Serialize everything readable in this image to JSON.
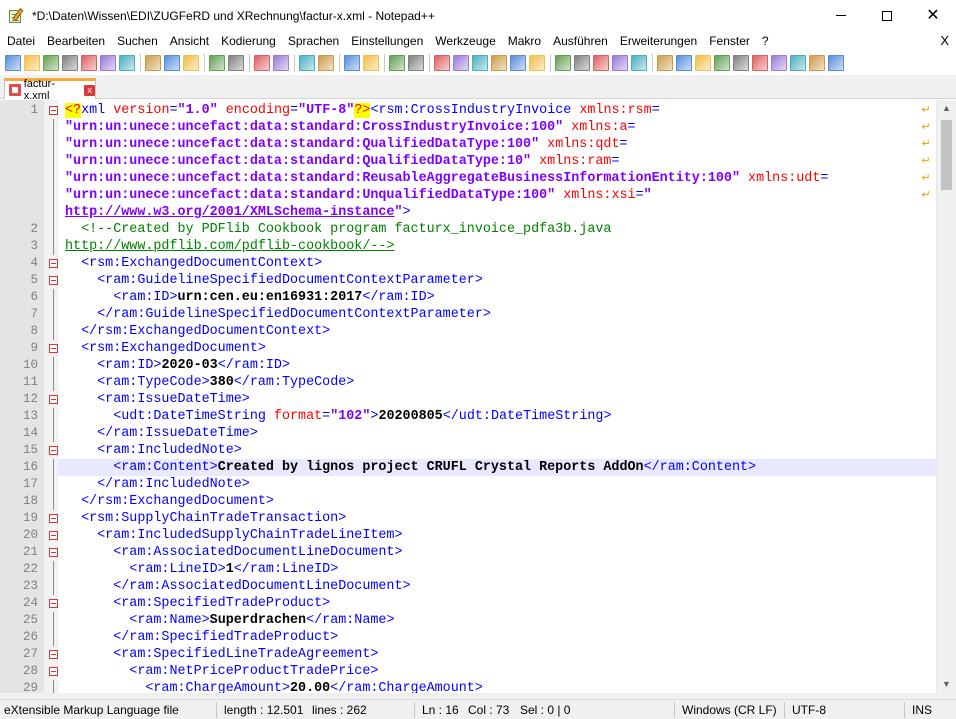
{
  "window": {
    "title": "*D:\\Daten\\Wissen\\EDI\\ZUGFeRD und XRechnung\\factur-x.xml - Notepad++"
  },
  "menu": {
    "items": [
      "Datei",
      "Bearbeiten",
      "Suchen",
      "Ansicht",
      "Kodierung",
      "Sprachen",
      "Einstellungen",
      "Werkzeuge",
      "Makro",
      "Ausführen",
      "Erweiterungen",
      "Fenster",
      "?"
    ],
    "close_label": "X"
  },
  "tab": {
    "label": "factur-x.xml",
    "close_label": "x"
  },
  "editor": {
    "current_line": 16,
    "lines": [
      {
        "num": "1",
        "html": "<span class=\"t-decl\">&lt;?</span><span class=\"t-tag\">xml </span><span class=\"t-attr\">version</span><span class=\"t-tag\">=</span><span class=\"t-val\">\"1.0\"</span><span class=\"t-tag\"> </span><span class=\"t-attr\">encoding</span><span class=\"t-tag\">=</span><span class=\"t-val\">\"UTF-8\"</span><span class=\"t-decl\">?&gt;</span><span class=\"t-tag\">&lt;rsm:CrossIndustryInvoice </span><span class=\"t-attr\">xmlns:rsm</span><span class=\"t-tag\">=</span>"
      },
      {
        "num": "",
        "html": "<span class=\"t-val\">\"urn:un:unece:uncefact:data:standard:CrossIndustryInvoice:100\"</span><span class=\"t-tag\"> </span><span class=\"t-attr\">xmlns:a</span><span class=\"t-tag\">=</span>"
      },
      {
        "num": "",
        "html": "<span class=\"t-val\">\"urn:un:unece:uncefact:data:standard:QualifiedDataType:100\"</span><span class=\"t-tag\"> </span><span class=\"t-attr\">xmlns:qdt</span><span class=\"t-tag\">=</span>"
      },
      {
        "num": "",
        "html": "<span class=\"t-val\">\"urn:un:unece:uncefact:data:standard:QualifiedDataType:10\"</span><span class=\"t-tag\"> </span><span class=\"t-attr\">xmlns:ram</span><span class=\"t-tag\">=</span>"
      },
      {
        "num": "",
        "html": "<span class=\"t-val\">\"urn:un:unece:uncefact:data:standard:ReusableAggregateBusinessInformationEntity:100\"</span><span class=\"t-tag\"> </span><span class=\"t-attr\">xmlns:udt</span><span class=\"t-tag\">=</span>"
      },
      {
        "num": "",
        "html": "<span class=\"t-val\">\"urn:un:unece:uncefact:data:standard:UnqualifiedDataType:100\"</span><span class=\"t-tag\"> </span><span class=\"t-attr\">xmlns:xsi</span><span class=\"t-tag\">=</span><span class=\"t-val\">\"</span>"
      },
      {
        "num": "",
        "html": "<span class=\"t-url\">http://www.w3.org/2001/XMLSchema-instance</span><span class=\"t-val\">\"</span><span class=\"t-tag\">&gt;</span>"
      },
      {
        "num": "2",
        "html": "<span class=\"t-comment\">  &lt;!--Created by PDFlib Cookbook program facturx_invoice_pdfa3b.java</span>"
      },
      {
        "num": "3",
        "html": "<span class=\"t-urlc\">http://www.pdflib.com/pdflib-cookbook/--&gt;</span>"
      },
      {
        "num": "4",
        "html": "<span class=\"t-tag\">  &lt;rsm:ExchangedDocumentContext&gt;</span>"
      },
      {
        "num": "5",
        "html": "<span class=\"t-tag\">    &lt;ram:GuidelineSpecifiedDocumentContextParameter&gt;</span>"
      },
      {
        "num": "6",
        "html": "<span class=\"t-tag\">      &lt;ram:ID&gt;</span><span class=\"t-text\">urn:cen.eu:en16931:2017</span><span class=\"t-tag\">&lt;/ram:ID&gt;</span>"
      },
      {
        "num": "7",
        "html": "<span class=\"t-tag\">    &lt;/ram:GuidelineSpecifiedDocumentContextParameter&gt;</span>"
      },
      {
        "num": "8",
        "html": "<span class=\"t-tag\">  &lt;/rsm:ExchangedDocumentContext&gt;</span>"
      },
      {
        "num": "9",
        "html": "<span class=\"t-tag\">  &lt;rsm:ExchangedDocument&gt;</span>"
      },
      {
        "num": "10",
        "html": "<span class=\"t-tag\">    &lt;ram:ID&gt;</span><span class=\"t-text\">2020-03</span><span class=\"t-tag\">&lt;/ram:ID&gt;</span>"
      },
      {
        "num": "11",
        "html": "<span class=\"t-tag\">    &lt;ram:TypeCode&gt;</span><span class=\"t-text\">380</span><span class=\"t-tag\">&lt;/ram:TypeCode&gt;</span>"
      },
      {
        "num": "12",
        "html": "<span class=\"t-tag\">    &lt;ram:IssueDateTime&gt;</span>"
      },
      {
        "num": "13",
        "html": "<span class=\"t-tag\">      &lt;udt:DateTimeString </span><span class=\"t-attr\">format</span><span class=\"t-tag\">=</span><span class=\"t-val\">\"102\"</span><span class=\"t-tag\">&gt;</span><span class=\"t-text\">20200805</span><span class=\"t-tag\">&lt;/udt:DateTimeString&gt;</span>"
      },
      {
        "num": "14",
        "html": "<span class=\"t-tag\">    &lt;/ram:IssueDateTime&gt;</span>"
      },
      {
        "num": "15",
        "html": "<span class=\"t-tag\">    &lt;ram:IncludedNote&gt;</span>"
      },
      {
        "num": "16",
        "html": "<span class=\"t-tag\">      &lt;ram:Content&gt;</span><span class=\"t-text\">Created by lignos project CRUFL Crystal Reports AddOn</span><span class=\"t-tag\">&lt;/ram:Content&gt;</span>"
      },
      {
        "num": "17",
        "html": "<span class=\"t-tag\">    &lt;/ram:IncludedNote&gt;</span>"
      },
      {
        "num": "18",
        "html": "<span class=\"t-tag\">  &lt;/rsm:ExchangedDocument&gt;</span>"
      },
      {
        "num": "19",
        "html": "<span class=\"t-tag\">  &lt;rsm:SupplyChainTradeTransaction&gt;</span>"
      },
      {
        "num": "20",
        "html": "<span class=\"t-tag\">    &lt;ram:IncludedSupplyChainTradeLineItem&gt;</span>"
      },
      {
        "num": "21",
        "html": "<span class=\"t-tag\">      &lt;ram:AssociatedDocumentLineDocument&gt;</span>"
      },
      {
        "num": "22",
        "html": "<span class=\"t-tag\">        &lt;ram:LineID&gt;</span><span class=\"t-text\">1</span><span class=\"t-tag\">&lt;/ram:LineID&gt;</span>"
      },
      {
        "num": "23",
        "html": "<span class=\"t-tag\">      &lt;/ram:AssociatedDocumentLineDocument&gt;</span>"
      },
      {
        "num": "24",
        "html": "<span class=\"t-tag\">      &lt;ram:SpecifiedTradeProduct&gt;</span>"
      },
      {
        "num": "25",
        "html": "<span class=\"t-tag\">        &lt;ram:Name&gt;</span><span class=\"t-text\">Superdrachen</span><span class=\"t-tag\">&lt;/ram:Name&gt;</span>"
      },
      {
        "num": "26",
        "html": "<span class=\"t-tag\">      &lt;/ram:SpecifiedTradeProduct&gt;</span>"
      },
      {
        "num": "27",
        "html": "<span class=\"t-tag\">      &lt;ram:SpecifiedLineTradeAgreement&gt;</span>"
      },
      {
        "num": "28",
        "html": "<span class=\"t-tag\">        &lt;ram:NetPriceProductTradePrice&gt;</span>"
      },
      {
        "num": "29",
        "html": "<span class=\"t-tag\">          &lt;ram:ChargeAmount&gt;</span><span class=\"t-text\">20.00</span><span class=\"t-tag\">&lt;/ram:ChargeAmount&gt;</span>"
      }
    ]
  },
  "status": {
    "file_type": "eXtensible Markup Language file",
    "length": "length : 12.501",
    "lines": "lines : 262",
    "ln": "Ln : 16",
    "col": "Col : 73",
    "sel": "Sel : 0 | 0",
    "eol": "Windows (CR LF)",
    "encoding": "UTF-8",
    "ins": "INS"
  },
  "toolbar_icons": [
    "new-file-icon",
    "open-file-icon",
    "save-icon",
    "save-all-icon",
    "close-icon",
    "close-all-icon",
    "print-icon",
    "cut-icon",
    "copy-icon",
    "paste-icon",
    "undo-icon",
    "redo-icon",
    "find-icon",
    "replace-icon",
    "zoom-in-icon",
    "zoom-out-icon",
    "sync-vertical-icon",
    "sync-horizontal-icon",
    "word-wrap-icon",
    "show-all-chars-icon",
    "indent-guide-icon",
    "udl-icon",
    "doc-map-icon",
    "function-list-icon",
    "folder-workspace-icon",
    "monitoring-icon",
    "record-macro-icon",
    "stop-record-icon",
    "play-macro-icon",
    "run-macro-multiple-icon",
    "save-macro-icon",
    "plugin-1-icon",
    "plugin-2-icon",
    "plugin-3-icon",
    "plugin-4-icon",
    "plugin-up-icon",
    "plugin-down-icon",
    "plugin-5-icon",
    "plugin-6-icon",
    "plugin-7-icon",
    "plugin-sql-icon"
  ]
}
